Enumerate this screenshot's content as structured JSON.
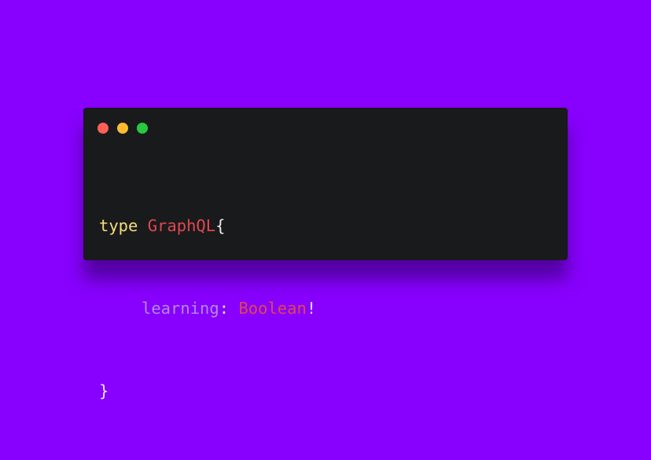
{
  "window": {
    "controls": [
      {
        "name": "close",
        "color": "#fe5f57"
      },
      {
        "name": "minimize",
        "color": "#febc2e"
      },
      {
        "name": "maximize",
        "color": "#28c840"
      }
    ]
  },
  "code": {
    "line1": {
      "keyword": "type",
      "space": " ",
      "type_name": "GraphQL",
      "brace_open": "{"
    },
    "line2": {
      "field": "learning",
      "colon": ": ",
      "field_type": "Boolean",
      "bang": "!"
    },
    "line3": {
      "brace_close": "}"
    }
  },
  "colors": {
    "background": "#8800fd",
    "editor": "#191a1c",
    "keyword": "#f5dd7a",
    "type": "#e0474f",
    "field": "#b189e6",
    "punctuation": "#e9e9e9"
  }
}
